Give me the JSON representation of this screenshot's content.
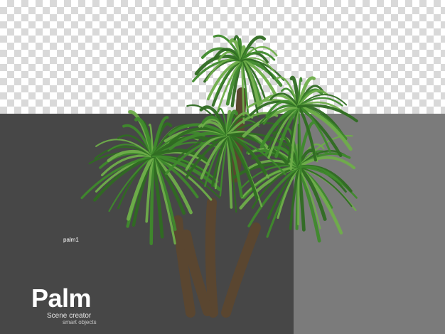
{
  "image": {
    "subject": "palm-cluster",
    "colors": {
      "checker_light": "#ffffff",
      "checker_dark": "#d9d9d9",
      "panel_dark": "#474747",
      "panel_light": "#7b7b7b",
      "frond_dark": "#2f6b22",
      "frond_mid": "#3f8a2c",
      "frond_light": "#6fae4a",
      "trunk": "#5a4630"
    }
  },
  "labels": {
    "model_name": "palm1",
    "title": "Palm",
    "subtitle": "Scene creator",
    "tagline": "smart objects"
  }
}
